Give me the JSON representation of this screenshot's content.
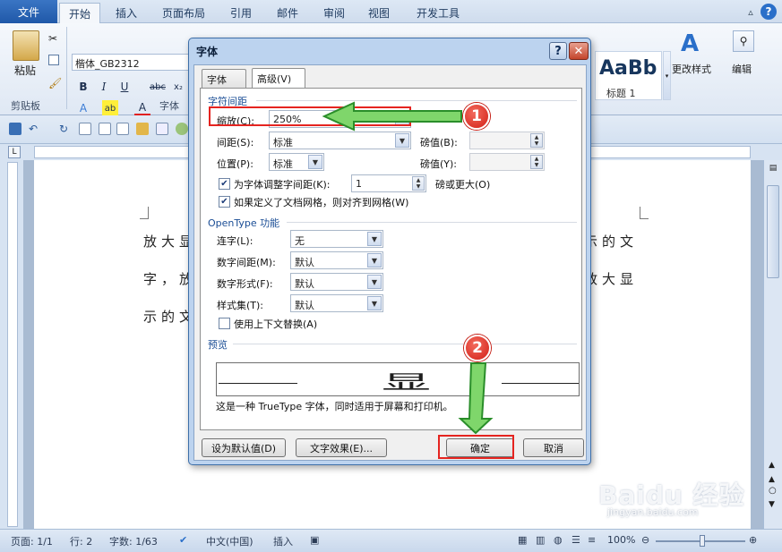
{
  "ribbon": {
    "file_tab": "文件",
    "tabs": [
      "开始",
      "插入",
      "页面布局",
      "引用",
      "邮件",
      "审阅",
      "视图",
      "开发工具"
    ],
    "font_name": "楷体_GB2312",
    "paste_label": "粘贴",
    "clipboard_group": "剪贴板",
    "font_group": "字体",
    "style_sample": "AaBb",
    "style_name": "标题 1",
    "change_styles": "更改样式",
    "editing": "编辑"
  },
  "document": {
    "lines": [
      "放大显",
      "字，放",
      "示的文"
    ],
    "right_fragments": [
      "示的文",
      "放大显"
    ]
  },
  "dialog": {
    "title": "字体",
    "tabs": [
      "字体(N)",
      "高级(V)"
    ],
    "section_spacing": "字符间距",
    "scale_label": "缩放(C):",
    "scale_value": "250%",
    "spacing_label": "间距(S):",
    "spacing_value": "标准",
    "spacing_by_label": "磅值(B):",
    "position_label": "位置(P):",
    "position_value": "标准",
    "position_by_label": "磅值(Y):",
    "kerning_label": "为字体调整字间距(K):",
    "kerning_value": "1",
    "kerning_suffix": "磅或更大(O)",
    "grid_label": "如果定义了文档网格，则对齐到网格(W)",
    "section_opentype": "OpenType 功能",
    "ligatures_label": "连字(L):",
    "ligatures_value": "无",
    "num_spacing_label": "数字间距(M):",
    "num_spacing_value": "默认",
    "num_forms_label": "数字形式(F):",
    "num_forms_value": "默认",
    "style_sets_label": "样式集(T):",
    "style_sets_value": "默认",
    "contextual_label": "使用上下文替换(A)",
    "section_preview": "预览",
    "preview_char": "显",
    "preview_note": "这是一种 TrueType 字体，同时适用于屏幕和打印机。",
    "set_default": "设为默认值(D)",
    "text_effects": "文字效果(E)...",
    "ok": "确定",
    "cancel": "取消"
  },
  "status": {
    "page": "页面: 1/1",
    "line": "行: 2",
    "words": "字数: 1/63",
    "language": "中文(中国)",
    "mode": "插入",
    "zoom": "100%"
  },
  "annotations": {
    "step1": "1",
    "step2": "2"
  },
  "watermark": {
    "logo": "Baidu 经验",
    "url": "jingyan.baidu.com"
  }
}
